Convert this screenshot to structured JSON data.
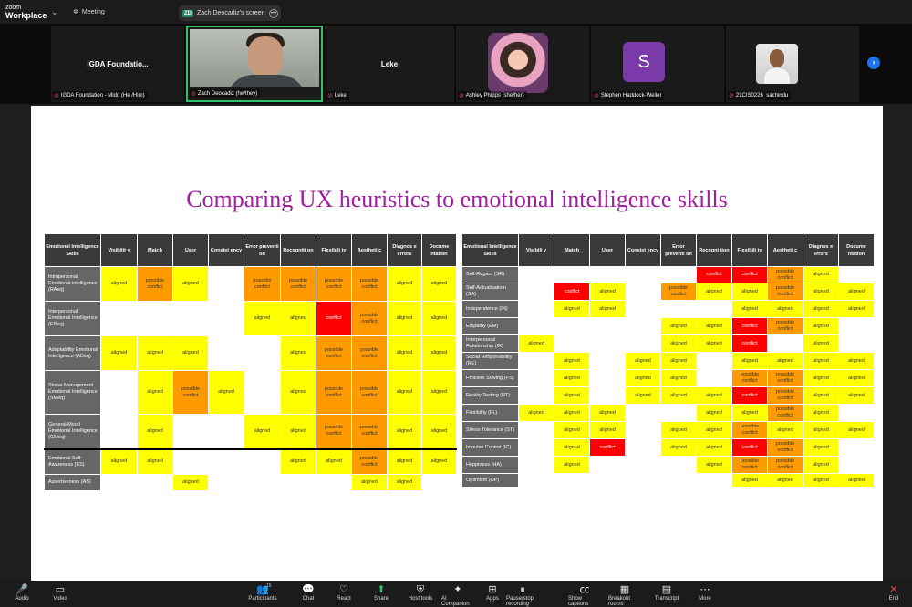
{
  "app": {
    "logo_line1": "zoom",
    "logo_line2": "Workplace",
    "meeting_label": "Meeting",
    "share_tab_badge": "ZD",
    "share_tab_label": "Zach Deocadiz's screen"
  },
  "participants": [
    {
      "name_label": "IGDA Foundation - Mido (He /Him)",
      "display": "IGDA  Foundatio..."
    },
    {
      "name_label": "Zach Deocadiz (he/they)"
    },
    {
      "name_label": "Leke",
      "display": "Leke"
    },
    {
      "name_label": "Ashley Phipps (she/her)"
    },
    {
      "name_label": "Stephen Haddock-Weiler",
      "initial": "S"
    },
    {
      "name_label": "21CIS0226_sachindu"
    }
  ],
  "slide": {
    "title": "Comparing UX heuristics to emotional intelligence skills"
  },
  "table_left": {
    "headers": [
      "Emotional Intelligence Skills",
      "Visibilit y",
      "Match",
      "User",
      "Consist ency",
      "Error preventi on",
      "Recogniti on",
      "Flexibili ty",
      "Aestheti c",
      "Diagnos e errors",
      "Docume ntation"
    ],
    "rows": [
      {
        "skill": "Intrapersonal Emotional intelligence (RAeq)",
        "cells": [
          "aligned",
          "possible conflict",
          "aligned",
          "",
          "possible conflict",
          "possible conflict",
          "possible conflict",
          "possible conflict",
          "aligned",
          "aligned"
        ]
      },
      {
        "skill": "Interpersonal Emotional Intelligence (EReq)",
        "cells": [
          "",
          "",
          "",
          "",
          "aligned",
          "aligned",
          "conflict",
          "possible conflict",
          "aligned",
          "aligned"
        ]
      },
      {
        "skill": "Adaptability Emotional Intelligence (ADeq)",
        "cells": [
          "aligned",
          "aligned",
          "aligned",
          "",
          "",
          "aligned",
          "possible conflict",
          "possible conflict",
          "aligned",
          "aligned"
        ]
      },
      {
        "skill": "Stress Management Emotional Intelligence (SMeq)",
        "cells": [
          "",
          "aligned",
          "possible conflict",
          "aligned",
          "",
          "aligned",
          "possible conflict",
          "possible conflict",
          "aligned",
          "aligned"
        ]
      },
      {
        "skill": "General Mood Emotional Intelligence (GMeq)",
        "cells": [
          "",
          "aligned",
          "",
          "",
          "aligned",
          "aligned",
          "possible conflict",
          "possible conflict",
          "aligned",
          "aligned"
        ]
      },
      {
        "skill": "Emotional Self-Awareness (ES)",
        "cells": [
          "aligned",
          "aligned",
          "",
          "",
          "",
          "aligned",
          "aligned",
          "possible conflict",
          "aligned",
          "aligned"
        ]
      },
      {
        "skill": "Assertiveness (AS)",
        "cells": [
          "",
          "",
          "aligned",
          "",
          "",
          "",
          "",
          "aligned",
          "aligned",
          ""
        ]
      }
    ]
  },
  "table_right": {
    "headers": [
      "Emotional Intelligence Skills",
      "Visibili y",
      "Match",
      "User",
      "Consist ency",
      "Error preventi on",
      "Recogni tion",
      "Flexibili ty",
      "Aestheti c",
      "Diagnos e errors",
      "Docume ntation"
    ],
    "rows": [
      {
        "skill": "Self-Regard (SR)",
        "cells": [
          "",
          "",
          "",
          "",
          "",
          "conflict",
          "conflict",
          "possible conflict",
          "aligned",
          ""
        ]
      },
      {
        "skill": "Self-Actualisatio n (SA)",
        "cells": [
          "",
          "conflict",
          "aligned",
          "",
          "possible conflict",
          "aligned",
          "aligned",
          "possible conflict",
          "aligned",
          "aligned"
        ]
      },
      {
        "skill": "Independence (IN)",
        "cells": [
          "",
          "aligned",
          "aligned",
          "",
          "",
          "",
          "aligned",
          "aligned",
          "aligned",
          "aligned"
        ]
      },
      {
        "skill": "Empathy (EM)",
        "cells": [
          "",
          "",
          "",
          "",
          "aligned",
          "aligned",
          "conflict",
          "possible conflict",
          "aligned",
          ""
        ]
      },
      {
        "skill": "Interpersonal Relationship (IR)",
        "cells": [
          "aligned",
          "",
          "",
          "",
          "aligned",
          "aligned",
          "conflict",
          "",
          "aligned",
          ""
        ]
      },
      {
        "skill": "Social Responsibility (RE)",
        "cells": [
          "",
          "aligned",
          "",
          "aligned",
          "aligned",
          "",
          "aligned",
          "aligned",
          "aligned",
          "aligned"
        ]
      },
      {
        "skill": "Problem Solving (PS)",
        "cells": [
          "",
          "aligned",
          "",
          "aligned",
          "aligned",
          "",
          "possible conflict",
          "possible conflict",
          "aligned",
          "aligned"
        ]
      },
      {
        "skill": "Reality Testing (RT)",
        "cells": [
          "",
          "aligned",
          "",
          "aligned",
          "aligned",
          "aligned",
          "conflict",
          "possible conflict",
          "aligned",
          "aligned"
        ]
      },
      {
        "skill": "Flexibility (FL)",
        "cells": [
          "aligned",
          "aligned",
          "aligned",
          "",
          "",
          "aligned",
          "aligned",
          "possible conflict",
          "aligned",
          ""
        ]
      },
      {
        "skill": "Stress Tolerance (ST)",
        "cells": [
          "",
          "aligned",
          "aligned",
          "",
          "aligned",
          "aligned",
          "possible conflict",
          "aligned",
          "aligned",
          "aligned"
        ]
      },
      {
        "skill": "Impulse Control (IC)",
        "cells": [
          "",
          "aligned",
          "conflict",
          "",
          "aligned",
          "aligned",
          "conflict",
          "possible conflict",
          "aligned",
          ""
        ]
      },
      {
        "skill": "Happiness (HA)",
        "cells": [
          "",
          "aligned",
          "",
          "",
          "",
          "aligned",
          "possible conflict",
          "possible conflict",
          "aligned",
          ""
        ]
      },
      {
        "skill": "Optimism (OP)",
        "cells": [
          "",
          "",
          "",
          "",
          "",
          "",
          "aligned",
          "aligned",
          "aligned",
          "aligned"
        ]
      }
    ]
  },
  "toolbar": [
    {
      "label": "Audio",
      "icon": "mic-muted-icon"
    },
    {
      "label": "Video",
      "icon": "camera-off-icon"
    },
    {
      "label": "Participants",
      "icon": "participants-icon",
      "count": "15"
    },
    {
      "label": "Chat",
      "icon": "chat-icon"
    },
    {
      "label": "React",
      "icon": "heart-icon"
    },
    {
      "label": "Share",
      "icon": "share-icon"
    },
    {
      "label": "Host tools",
      "icon": "shield-icon"
    },
    {
      "label": "AI Companion",
      "icon": "sparkle-icon"
    },
    {
      "label": "Apps",
      "icon": "apps-icon"
    },
    {
      "label": "Pause/stop recording",
      "icon": "pause-icon"
    },
    {
      "label": "Show captions",
      "icon": "cc-icon"
    },
    {
      "label": "Breakout rooms",
      "icon": "grid-icon"
    },
    {
      "label": "Transcript",
      "icon": "transcript-icon"
    },
    {
      "label": "More",
      "icon": "more-icon"
    },
    {
      "label": "End",
      "icon": "end-icon"
    }
  ],
  "colors": {
    "aligned": "#ffff00",
    "possible": "#ff9900",
    "conflict": "#ff0000",
    "title": "#a01fa0"
  }
}
